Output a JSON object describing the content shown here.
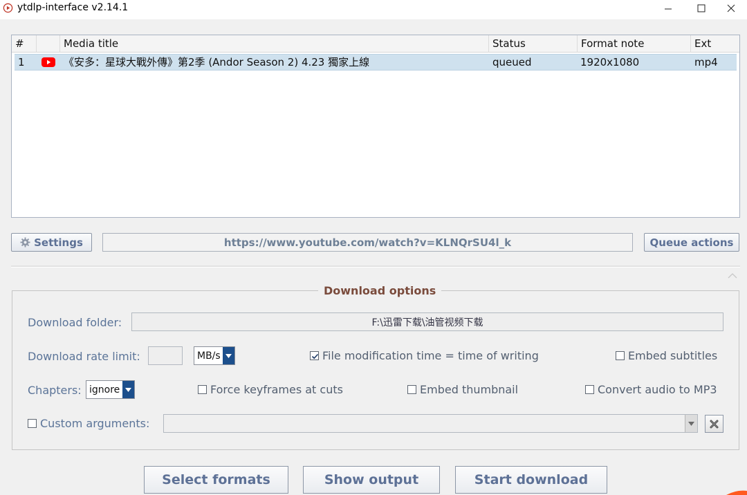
{
  "window": {
    "title": "ytdlp-interface v2.14.1",
    "controls": [
      "minimize",
      "maximize",
      "close"
    ]
  },
  "list": {
    "columns": [
      "#",
      "",
      "Media title",
      "Status",
      "Format note",
      "Ext"
    ],
    "rows": [
      {
        "index": "1",
        "source_icon": "youtube-icon",
        "title": "《安多：星球大戰外傳》第2季 (Andor Season 2) 4.23 獨家上線",
        "status": "queued",
        "format_note": "1920x1080",
        "ext": "mp4"
      }
    ]
  },
  "toolbar": {
    "settings_label": "Settings",
    "url": "https://www.youtube.com/watch?v=KLNQrSU4l_k",
    "queue_actions_label": "Queue actions"
  },
  "download_options": {
    "title": "Download options",
    "folder_label": "Download folder:",
    "folder_value": "F:\\迅雷下载\\油管视频下载",
    "rate_limit_label": "Download rate limit:",
    "rate_limit_value": "",
    "rate_unit": "MB/s",
    "file_mtime_label": "File modification time = time of writing",
    "file_mtime_checked": true,
    "embed_subtitles_label": "Embed subtitles",
    "embed_subtitles_checked": false,
    "chapters_label": "Chapters:",
    "chapters_value": "ignore",
    "force_keyframes_label": "Force keyframes at cuts",
    "force_keyframes_checked": false,
    "embed_thumbnail_label": "Embed thumbnail",
    "embed_thumbnail_checked": false,
    "convert_mp3_label": "Convert audio to MP3",
    "convert_mp3_checked": false,
    "custom_args_label": "Custom arguments:",
    "custom_args_checked": false,
    "custom_args_value": ""
  },
  "actions": {
    "select_formats_label": "Select formats",
    "show_output_label": "Show output",
    "start_download_label": "Start download"
  },
  "colors": {
    "accent_label": "#5b7498",
    "button_text": "#5d7196",
    "group_title": "#7a4b3c",
    "selection": "#cfe1ee",
    "youtube_red": "#ff0000"
  }
}
